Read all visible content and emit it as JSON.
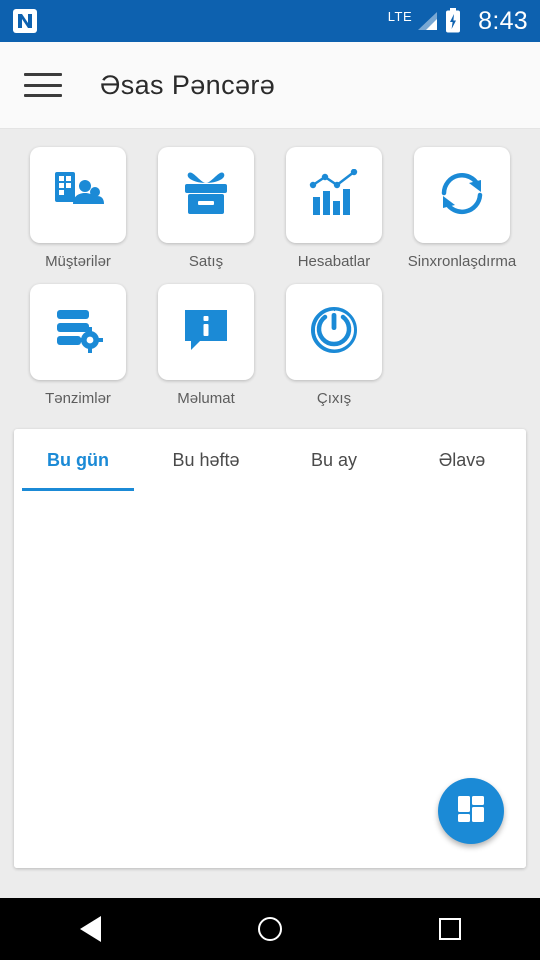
{
  "statusbar": {
    "notification_icon": "n-logo-icon",
    "network_label": "LTE",
    "signal_icon": "signal-bars-icon",
    "battery_icon": "battery-charging-icon",
    "time": "8:43"
  },
  "appbar": {
    "menu_icon": "hamburger-menu-icon",
    "title": "Əsas Pəncərə"
  },
  "tiles": [
    {
      "label": "Müştərilər",
      "icon": "customers-icon"
    },
    {
      "label": "Satış",
      "icon": "sales-box-icon"
    },
    {
      "label": "Hesabatlar",
      "icon": "reports-chart-icon"
    },
    {
      "label": "Sinxronlaşdırma",
      "icon": "sync-refresh-icon"
    },
    {
      "label": "Tənzimlər",
      "icon": "settings-database-icon"
    },
    {
      "label": "Məlumat",
      "icon": "info-message-icon"
    },
    {
      "label": "Çıxış",
      "icon": "power-off-icon"
    }
  ],
  "tabs": [
    {
      "label": "Bu gün",
      "active": true
    },
    {
      "label": "Bu həftə",
      "active": false
    },
    {
      "label": "Bu ay",
      "active": false
    },
    {
      "label": "Əlavə",
      "active": false
    }
  ],
  "fab": {
    "icon": "dashboard-grid-icon"
  },
  "navbar": {
    "back": "back-triangle-icon",
    "home": "home-circle-icon",
    "recents": "recents-square-icon"
  },
  "colors": {
    "status_bar": "#0d61af",
    "accent": "#1b8ad6",
    "app_bar": "#fafafa",
    "background": "#ececec"
  }
}
